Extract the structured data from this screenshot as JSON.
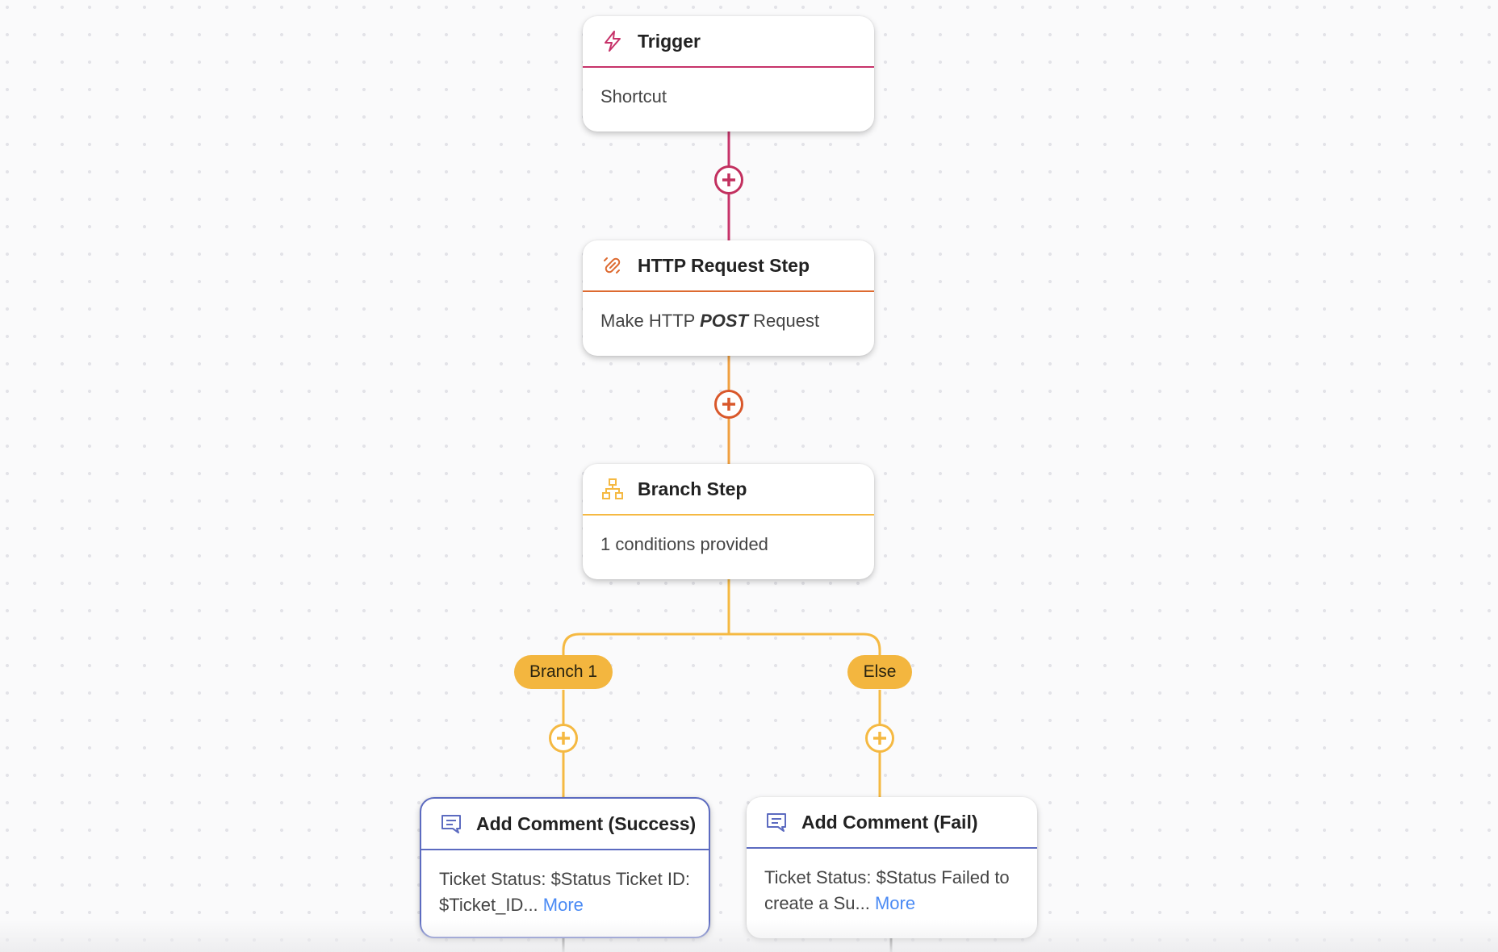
{
  "colors": {
    "trigger": "#c7336a",
    "http": "#dd6a30",
    "http_line": "#f0a040",
    "branch": "#f5b942",
    "comment": "#5c6bc0",
    "link": "#4a8af4"
  },
  "nodes": {
    "trigger": {
      "icon": "lightning-icon",
      "title": "Trigger",
      "body": "Shortcut"
    },
    "http": {
      "icon": "link-icon",
      "title": "HTTP Request Step",
      "body_prefix": "Make HTTP",
      "body_method": "POST",
      "body_suffix": "Request"
    },
    "branch": {
      "icon": "sitemap-icon",
      "title": "Branch Step",
      "body": "1 conditions provided"
    },
    "comment_success": {
      "icon": "comment-icon",
      "title": "Add Comment (Success)",
      "body": "Ticket Status: $Status Ticket ID: $Ticket_ID...",
      "more": "More",
      "selected": true
    },
    "comment_fail": {
      "icon": "comment-icon",
      "title": "Add Comment (Fail)",
      "body": "Ticket Status: $Status Failed to create a Su...",
      "more": "More",
      "selected": false
    }
  },
  "branches": [
    {
      "label": "Branch 1"
    },
    {
      "label": "Else"
    }
  ]
}
